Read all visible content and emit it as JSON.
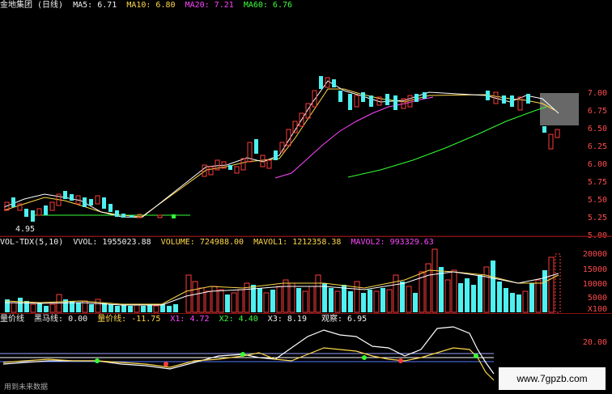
{
  "main_header": {
    "title": "金地集团 (日线)",
    "ma5": "MA5: 6.71",
    "ma10": "MA10: 6.80",
    "ma20": "MA20: 7.21",
    "ma60": "MA60: 6.76"
  },
  "price_axis": [
    "7.00",
    "6.75",
    "6.50",
    "6.25",
    "6.00",
    "5.75",
    "5.50",
    "5.25",
    "5.00"
  ],
  "low_marker": "4.95",
  "vol_header": {
    "name": "VOL-TDX(5,10)",
    "vvol": "VVOL: 1955023.88",
    "volume": "VOLUME: 724988.00",
    "mavol1": "MAVOL1: 1212358.38",
    "mavol2": "MAVOL2: 993329.63"
  },
  "vol_axis": [
    "20000",
    "15000",
    "10000",
    "5000",
    "X100"
  ],
  "ind_header": {
    "name": "量价线",
    "black_horse": "黑马线: 0.00",
    "price_vol_line": "量价线: -11.75",
    "x1": "X1: 4.72",
    "x2": "X2: 4.40",
    "x3": "X3: 8.19",
    "hidden": "",
    "observe": "观察: 6.95"
  },
  "ind_axis": [
    "20.00"
  ],
  "footer": "用到未来数据",
  "watermark": "www.7gpzb.com",
  "colors": {
    "up": "#ff3b3b",
    "down": "#4ef0f0",
    "ma5": "#ffffff",
    "ma10": "#ffd84a",
    "ma20": "#ff45ff",
    "ma60": "#33ff33"
  },
  "chart_data": [
    {
      "type": "candlestick",
      "title": "金地集团 (日线)",
      "ylim": [
        4.95,
        7.05
      ],
      "series": [
        {
          "name": "MA5",
          "value": 6.71
        },
        {
          "name": "MA10",
          "value": 6.8
        },
        {
          "name": "MA20",
          "value": 7.21
        },
        {
          "name": "MA60",
          "value": 6.76
        }
      ]
    },
    {
      "type": "bar",
      "title": "VOL-TDX(5,10)",
      "ylim": [
        0,
        20000
      ]
    },
    {
      "type": "line",
      "title": "量价线",
      "series": [
        {
          "name": "黑马线",
          "value": 0.0
        },
        {
          "name": "量价线",
          "value": -11.75
        },
        {
          "name": "X1",
          "value": 4.72
        },
        {
          "name": "X2",
          "value": 4.4
        },
        {
          "name": "X3",
          "value": 8.19
        },
        {
          "name": "观察",
          "value": 6.95
        }
      ]
    }
  ]
}
